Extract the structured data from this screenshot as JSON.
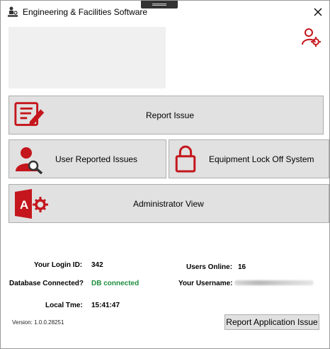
{
  "window": {
    "title": "Engineering & Facilities Software"
  },
  "buttons": {
    "report_issue": "Report Issue",
    "user_reported_issues": "User Reported Issues",
    "equipment_lock_off": "Equipment Lock Off System",
    "administrator_view": "Administrator View",
    "report_application_issue": "Report Application Issue"
  },
  "info": {
    "login_id_label": "Your Login ID:",
    "login_id_value": "342",
    "db_label": "Database Connected?",
    "db_value": "DB connected",
    "local_time_label": "Local Tme:",
    "local_time_value": "15:41:47",
    "users_online_label": "Users Online:",
    "users_online_value": "16",
    "username_label": "Your Username:"
  },
  "version": "Version: 1.0.0.28251",
  "colors": {
    "accent_red": "#c4161c",
    "status_green": "#1e8e3e",
    "button_bg": "#e1e1e1"
  },
  "icons": [
    "app-logo-icon",
    "close-icon",
    "user-settings-icon",
    "report-form-icon",
    "user-search-icon",
    "padlock-icon",
    "access-app-icon"
  ]
}
